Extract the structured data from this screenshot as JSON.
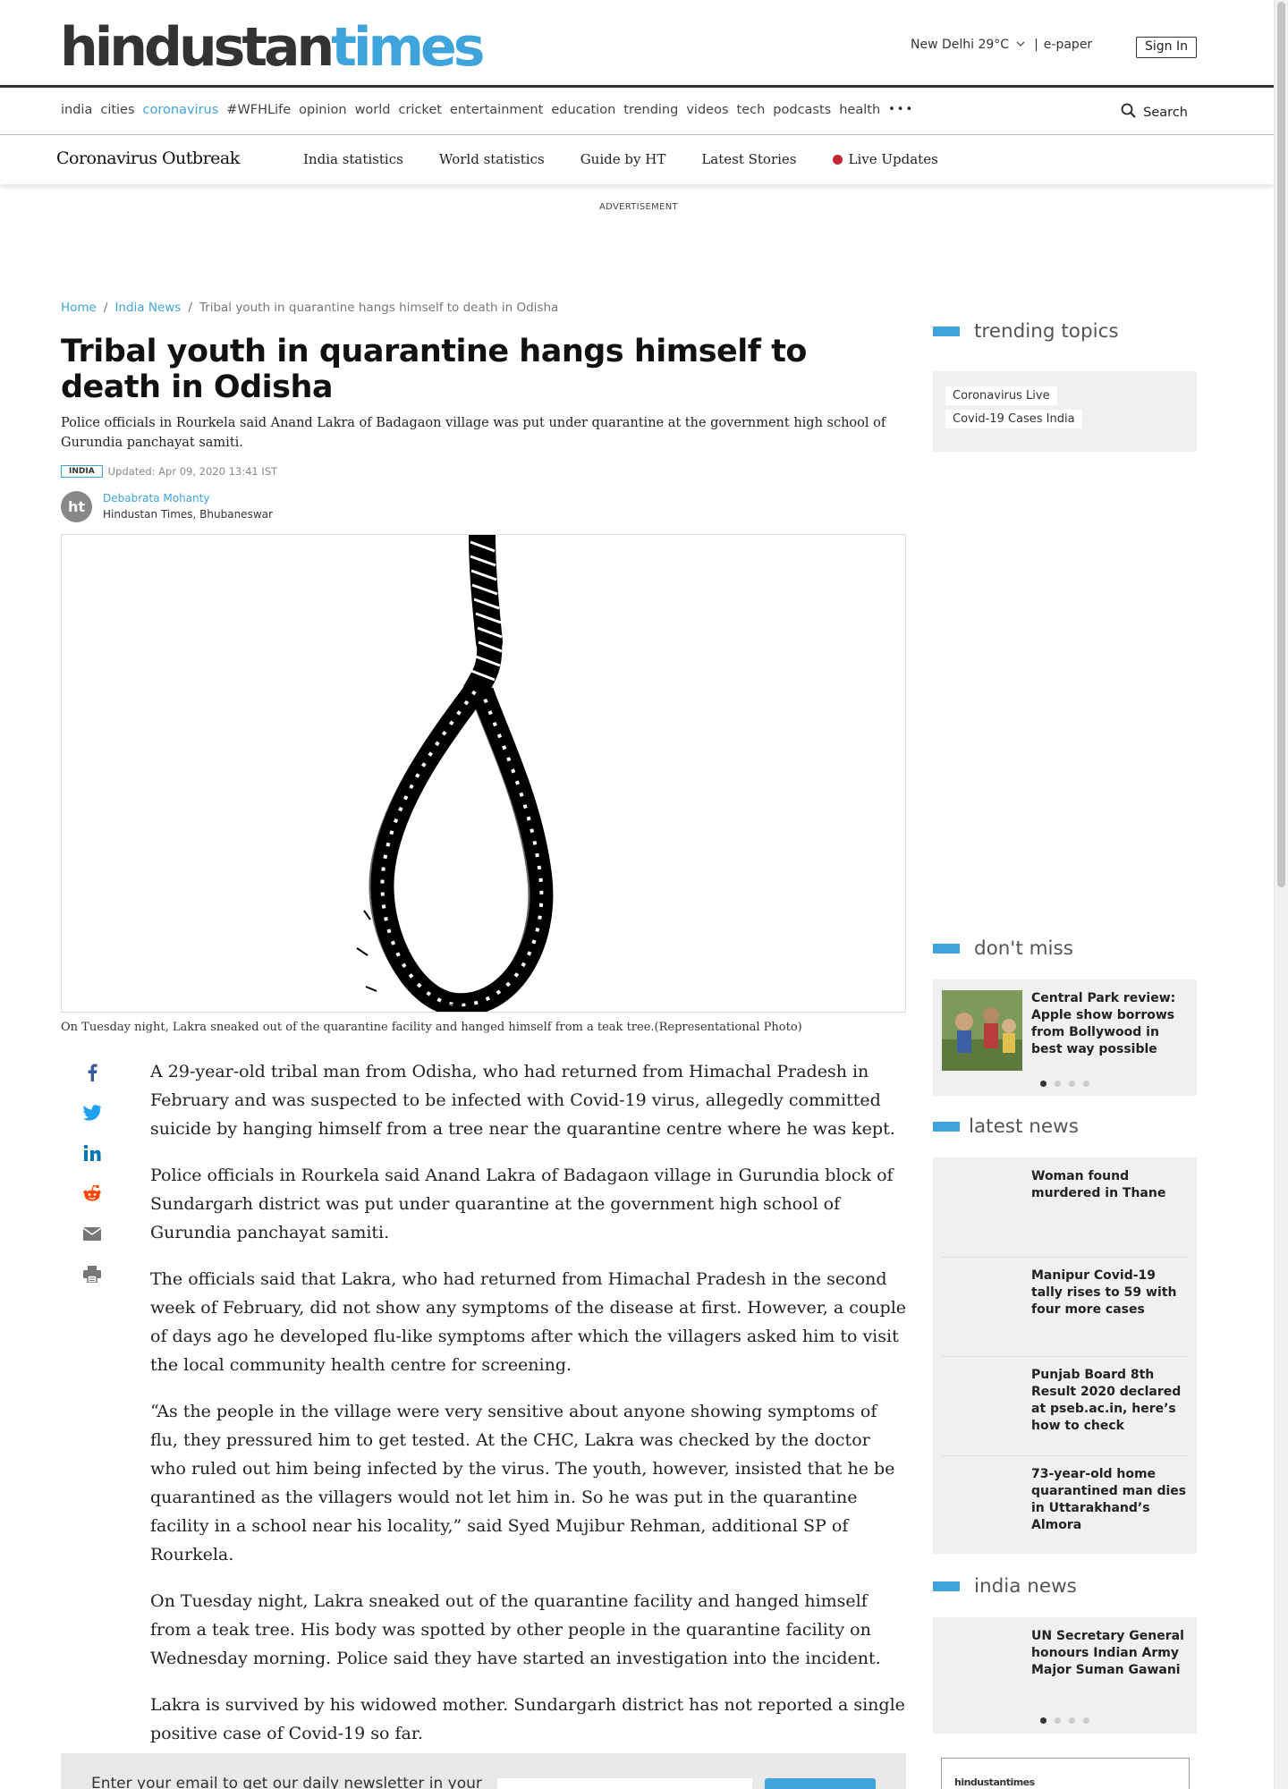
{
  "header": {
    "logo_part1": "hindustan",
    "logo_part2": "times",
    "weather": "New Delhi 29°C",
    "separator": "|",
    "epaper": "e-paper",
    "signin": "Sign In",
    "brand_color": "#3fa4dc"
  },
  "nav": {
    "items": [
      "india",
      "cities",
      "coronavirus",
      "#WFHLife",
      "opinion",
      "world",
      "cricket",
      "entertainment",
      "education",
      "trending",
      "videos",
      "tech",
      "podcasts",
      "health"
    ],
    "active": "coronavirus",
    "more": "•••",
    "search": "Search"
  },
  "corona_bar": {
    "title": "Coronavirus Outbreak",
    "links": [
      "India statistics",
      "World statistics",
      "Guide by HT",
      "Latest Stories"
    ],
    "live": "Live Updates"
  },
  "advertisement": "ADVERTISEMENT",
  "breadcrumb": {
    "home": "Home",
    "sep": "/",
    "section": "India News",
    "current": "Tribal youth in quarantine hangs himself to death in Odisha"
  },
  "article": {
    "title": "Tribal youth in quarantine hangs himself to death in Odisha",
    "summary": "Police officials in Rourkela said Anand Lakra of Badagaon village was put under quarantine at the government high school of Gurundia panchayat samiti.",
    "tag": "INDIA",
    "updated": "Updated: Apr 09, 2020 13:41 IST",
    "author_initials": "ht",
    "author": "Debabrata Mohanty",
    "author_org": "Hindustan Times, Bhubaneswar",
    "caption": "On Tuesday night, Lakra sneaked out of the quarantine facility and hanged himself from a teak tree.(Representational Photo)",
    "paragraphs": [
      "A 29-year-old tribal man from Odisha, who had returned from Himachal Pradesh in February and was suspected to be infected with Covid-19 virus, allegedly committed suicide by hanging himself from a tree near the quarantine centre where he was kept.",
      "Police officials in Rourkela said Anand Lakra of Badagaon village in Gurundia block of Sundargarh district was put under quarantine at the government high school of Gurundia panchayat samiti.",
      "The officials said that Lakra, who had returned from Himachal Pradesh in the second week of February, did not show any symptoms of the disease at first. However, a couple of days ago he developed flu-like symptoms after which the villagers asked him to visit the local community health centre for screening.",
      "“As the people in the village were very sensitive about anyone showing symptoms of flu, they pressured him to get tested. At the CHC, Lakra was checked by the doctor who ruled out him being infected by the virus. The youth, however, insisted that he be quarantined as the villagers would not let him in. So he was put in the quarantine facility in a school near his locality,” said Syed Mujibur Rehman, additional SP of Rourkela.",
      "On Tuesday night, Lakra sneaked out of the quarantine facility and hanged himself from a teak tree. His body was spotted by other people in the quarantine facility on Wednesday morning. Police said they have started an investigation into the incident.",
      "Lakra is survived by his widowed mother. Sundargarh district has not reported a single positive case of Covid-19 so far."
    ]
  },
  "share_icons": [
    "facebook-icon",
    "twitter-icon",
    "linkedin-icon",
    "reddit-icon",
    "email-icon",
    "print-icon"
  ],
  "newsletter": {
    "text": "Enter your email to get our daily newsletter in your"
  },
  "sidebar": {
    "trending": {
      "heading": "trending topics",
      "topics": [
        "Coronavirus Live",
        "Covid-19 Cases India"
      ]
    },
    "dont_miss": {
      "heading": "don't miss",
      "headline": "Central Park review: Apple show borrows from Bollywood in best way possible"
    },
    "latest": {
      "heading": "latest news",
      "items": [
        "Woman found murdered in Thane",
        "Manipur Covid-19 tally rises to 59 with four more cases",
        "Punjab Board 8th Result 2020 declared at pseb.ac.in, here’s how to check",
        "73-year-old home quarantined man dies in Uttarakhand’s Almora"
      ]
    },
    "india_news": {
      "heading": "india news",
      "headline": "UN Secretary General honours Indian Army Major Suman Gawani"
    },
    "ad_logo": "hindustantimes"
  }
}
